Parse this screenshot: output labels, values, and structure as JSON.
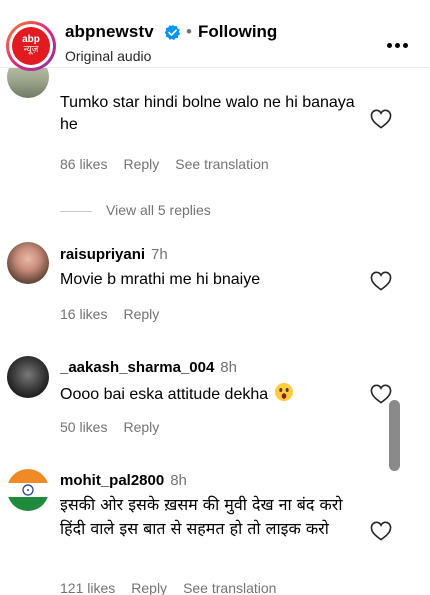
{
  "header": {
    "channel_name": "abpnewstv",
    "separator": "•",
    "follow_label": "Following",
    "audio_label": "Original audio",
    "logo_text_1": "abp",
    "logo_text_2": "न्यूज़"
  },
  "comments": [
    {
      "username": "",
      "time": "",
      "text": "Tumko star hindi bolne walo ne hi banaya he",
      "likes": "86 likes",
      "reply": "Reply",
      "translate": "See translation",
      "view_replies": "View all 5 replies"
    },
    {
      "username": "raisupriyani",
      "time": "7h",
      "text": "Movie b mrathi me hi bnaiye",
      "likes": "16 likes",
      "reply": "Reply"
    },
    {
      "username": "_aakash_sharma_004",
      "time": "8h",
      "text": "Oooo bai eska attitude dekha",
      "likes": "50 likes",
      "reply": "Reply"
    },
    {
      "username": "mohit_pal2800",
      "time": "8h",
      "text": "इसकी ओर इसके ख़सम की मुवी देख ना बंद करो हिंदी वाले इस बात से सहमत हो तो लाइक करो",
      "likes": "121 likes",
      "reply": "Reply",
      "translate": "See translation"
    }
  ],
  "colors": {
    "verified": "#0095f6",
    "logo_red": "#e21b22",
    "muted_text": "#737373"
  }
}
